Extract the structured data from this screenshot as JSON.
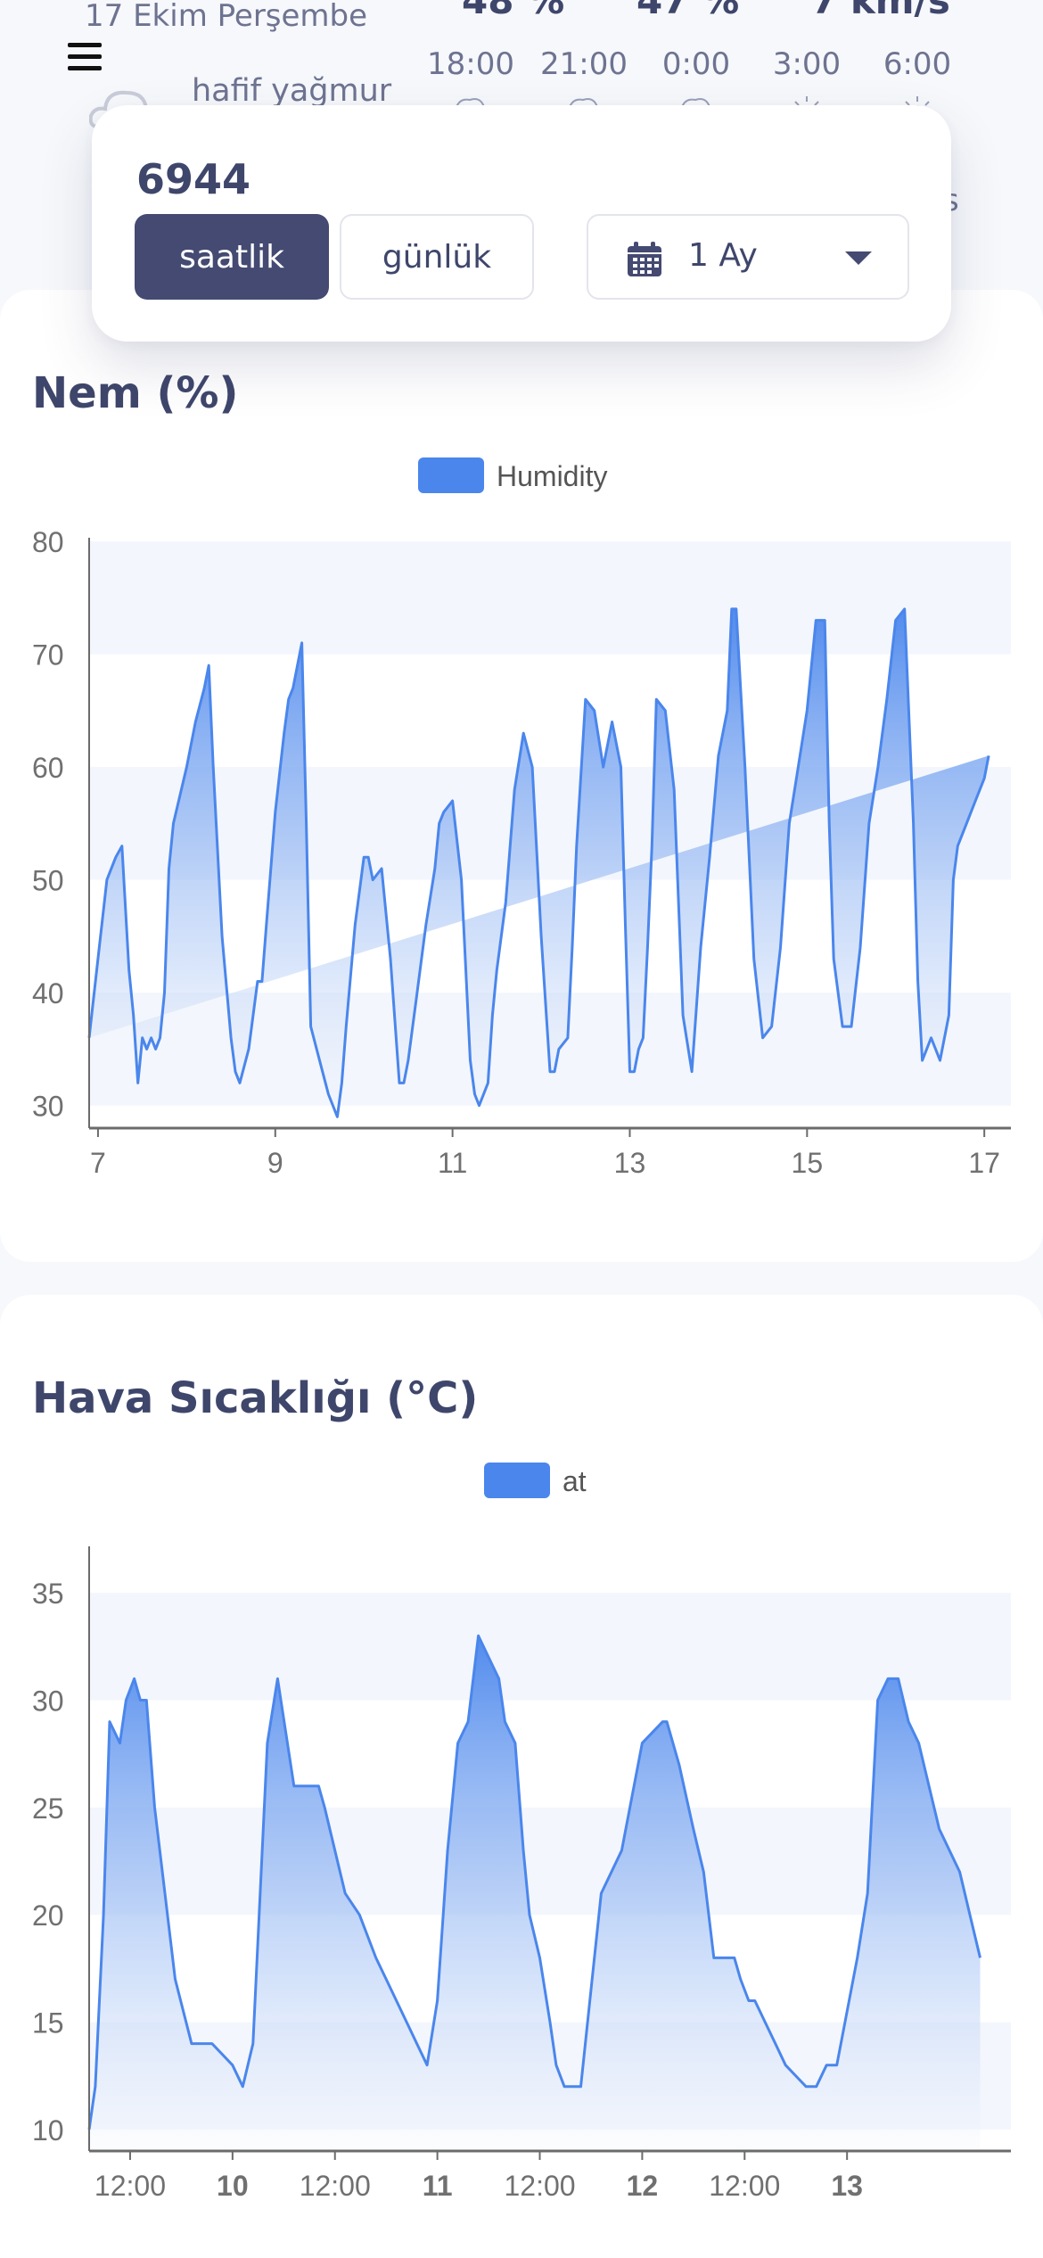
{
  "header": {
    "date": "17 Ekim Perşembe",
    "condition": "hafif yağmur",
    "stats": [
      "48 %",
      "47 %",
      "7 km/s"
    ],
    "hours": [
      "18:00",
      "21:00",
      "0:00",
      "3:00",
      "6:00"
    ],
    "partial_text": "s"
  },
  "controls": {
    "count": "6944",
    "hourly_label": "saatlik",
    "daily_label": "günlük",
    "range_label": "1 Ay"
  },
  "chart_data": [
    {
      "type": "area",
      "title": "Nem (%)",
      "legend": "Humidity",
      "ylim": [
        28,
        80
      ],
      "yticks": [
        30,
        40,
        50,
        60,
        70,
        80
      ],
      "xlim": [
        6.9,
        17.3
      ],
      "xticks": [
        7,
        9,
        11,
        13,
        15,
        17
      ],
      "color": "#4a86ec",
      "grid": "horizontal bands",
      "x": [
        6.9,
        7.0,
        7.1,
        7.2,
        7.27,
        7.35,
        7.4,
        7.45,
        7.5,
        7.55,
        7.6,
        7.65,
        7.7,
        7.75,
        7.8,
        7.85,
        8.0,
        8.1,
        8.2,
        8.25,
        8.3,
        8.4,
        8.5,
        8.55,
        8.6,
        8.7,
        8.8,
        8.85,
        8.9,
        9.0,
        9.1,
        9.15,
        9.2,
        9.3,
        9.35,
        9.4,
        9.5,
        9.6,
        9.7,
        9.75,
        9.8,
        9.9,
        10.0,
        10.05,
        10.1,
        10.2,
        10.3,
        10.4,
        10.45,
        10.5,
        10.6,
        10.7,
        10.8,
        10.85,
        10.9,
        11.0,
        11.1,
        11.2,
        11.25,
        11.3,
        11.4,
        11.45,
        11.5,
        11.6,
        11.7,
        11.8,
        11.9,
        12.0,
        12.1,
        12.15,
        12.2,
        12.3,
        12.35,
        12.4,
        12.5,
        12.6,
        12.7,
        12.8,
        12.9,
        12.95,
        13.0,
        13.05,
        13.1,
        13.15,
        13.2,
        13.25,
        13.3,
        13.4,
        13.5,
        13.6,
        13.7,
        13.8,
        13.9,
        14.0,
        14.1,
        14.15,
        14.2,
        14.3,
        14.4,
        14.5,
        14.6,
        14.7,
        14.8,
        14.9,
        15.0,
        15.1,
        15.2,
        15.25,
        15.3,
        15.4,
        15.5,
        15.6,
        15.7,
        15.8,
        15.9,
        16.0,
        16.1,
        16.2,
        16.25,
        16.3,
        16.4,
        16.5,
        16.6,
        16.65,
        16.7,
        16.8,
        16.9,
        17.0,
        17.05,
        17.1,
        17.15,
        17.2,
        17.25,
        17.3
      ],
      "values": [
        36,
        43,
        50,
        52,
        53,
        42,
        38,
        32,
        36,
        35,
        36,
        35,
        36,
        40,
        51,
        55,
        60,
        64,
        67,
        69,
        60,
        45,
        36,
        33,
        32,
        35,
        41,
        41,
        46,
        56,
        63,
        66,
        67,
        71,
        55,
        37,
        34,
        31,
        29,
        32,
        37,
        46,
        52,
        52,
        50,
        51,
        43,
        32,
        32,
        34,
        40,
        46,
        51,
        55,
        56,
        57,
        50,
        34,
        31,
        30,
        32,
        38,
        42,
        48,
        58,
        63,
        60,
        45,
        33,
        33,
        35,
        36,
        44,
        53,
        66,
        65,
        60,
        64,
        60,
        46,
        33,
        33,
        35,
        36,
        44,
        53,
        66,
        65,
        58,
        38,
        33,
        44,
        52,
        61,
        65,
        74,
        74,
        60,
        43,
        36,
        37,
        44,
        55,
        60,
        65,
        73,
        73,
        55,
        43,
        37,
        37,
        44,
        55,
        60,
        66,
        73,
        74,
        55,
        41,
        34,
        36,
        34,
        38,
        50,
        53,
        55,
        57,
        59,
        61
      ],
      "series_name": "Humidity"
    },
    {
      "type": "area",
      "title": "Hava Sıcaklığı (°C)",
      "legend": "at",
      "ylim": [
        9,
        37
      ],
      "yticks": [
        10,
        15,
        20,
        25,
        30,
        35
      ],
      "xlim": [
        9.3,
        13.8
      ],
      "xticks": [
        {
          "x": 9.5,
          "label": "12:00",
          "bold": false
        },
        {
          "x": 10.0,
          "label": "10",
          "bold": true
        },
        {
          "x": 10.5,
          "label": "12:00",
          "bold": false
        },
        {
          "x": 11.0,
          "label": "11",
          "bold": true
        },
        {
          "x": 11.5,
          "label": "12:00",
          "bold": false
        },
        {
          "x": 12.0,
          "label": "12",
          "bold": true
        },
        {
          "x": 12.5,
          "label": "12:00",
          "bold": false
        },
        {
          "x": 13.0,
          "label": "13",
          "bold": true
        }
      ],
      "color": "#4a86ec",
      "grid": "horizontal bands",
      "x": [
        9.3,
        9.33,
        9.37,
        9.4,
        9.45,
        9.48,
        9.52,
        9.55,
        9.58,
        9.62,
        9.67,
        9.72,
        9.8,
        9.9,
        10.0,
        10.05,
        10.1,
        10.13,
        10.17,
        10.22,
        10.3,
        10.35,
        10.42,
        10.45,
        10.5,
        10.55,
        10.62,
        10.7,
        10.75,
        10.8,
        10.85,
        10.9,
        10.95,
        11.0,
        11.05,
        11.1,
        11.15,
        11.2,
        11.25,
        11.3,
        11.33,
        11.38,
        11.42,
        11.45,
        11.5,
        11.55,
        11.58,
        11.62,
        11.65,
        11.7,
        11.8,
        11.9,
        12.0,
        12.1,
        12.12,
        12.18,
        12.25,
        12.3,
        12.35,
        12.4,
        12.45,
        12.48,
        12.52,
        12.55,
        12.6,
        12.65,
        12.7,
        12.8,
        12.82,
        12.85,
        12.9,
        12.95,
        13.05,
        13.1,
        13.15,
        13.2,
        13.25,
        13.3,
        13.35,
        13.4,
        13.45,
        13.5,
        13.55,
        13.6,
        13.65
      ],
      "values": [
        10,
        12,
        20,
        29,
        28,
        30,
        31,
        30,
        30,
        25,
        21,
        17,
        14,
        14,
        13,
        12,
        14,
        20,
        28,
        31,
        26,
        26,
        26,
        25,
        23,
        21,
        20,
        18,
        17,
        16,
        15,
        14,
        13,
        16,
        23,
        28,
        29,
        33,
        32,
        31,
        29,
        28,
        23,
        20,
        18,
        15,
        13,
        12,
        12,
        12,
        21,
        23,
        28,
        29,
        29,
        27,
        24,
        22,
        18,
        18,
        18,
        17,
        16,
        16,
        15,
        14,
        13,
        12,
        12,
        12,
        13,
        13,
        18,
        21,
        30,
        31,
        31,
        29,
        28,
        26,
        24,
        23,
        22,
        20,
        18
      ],
      "series_name": "at"
    }
  ]
}
